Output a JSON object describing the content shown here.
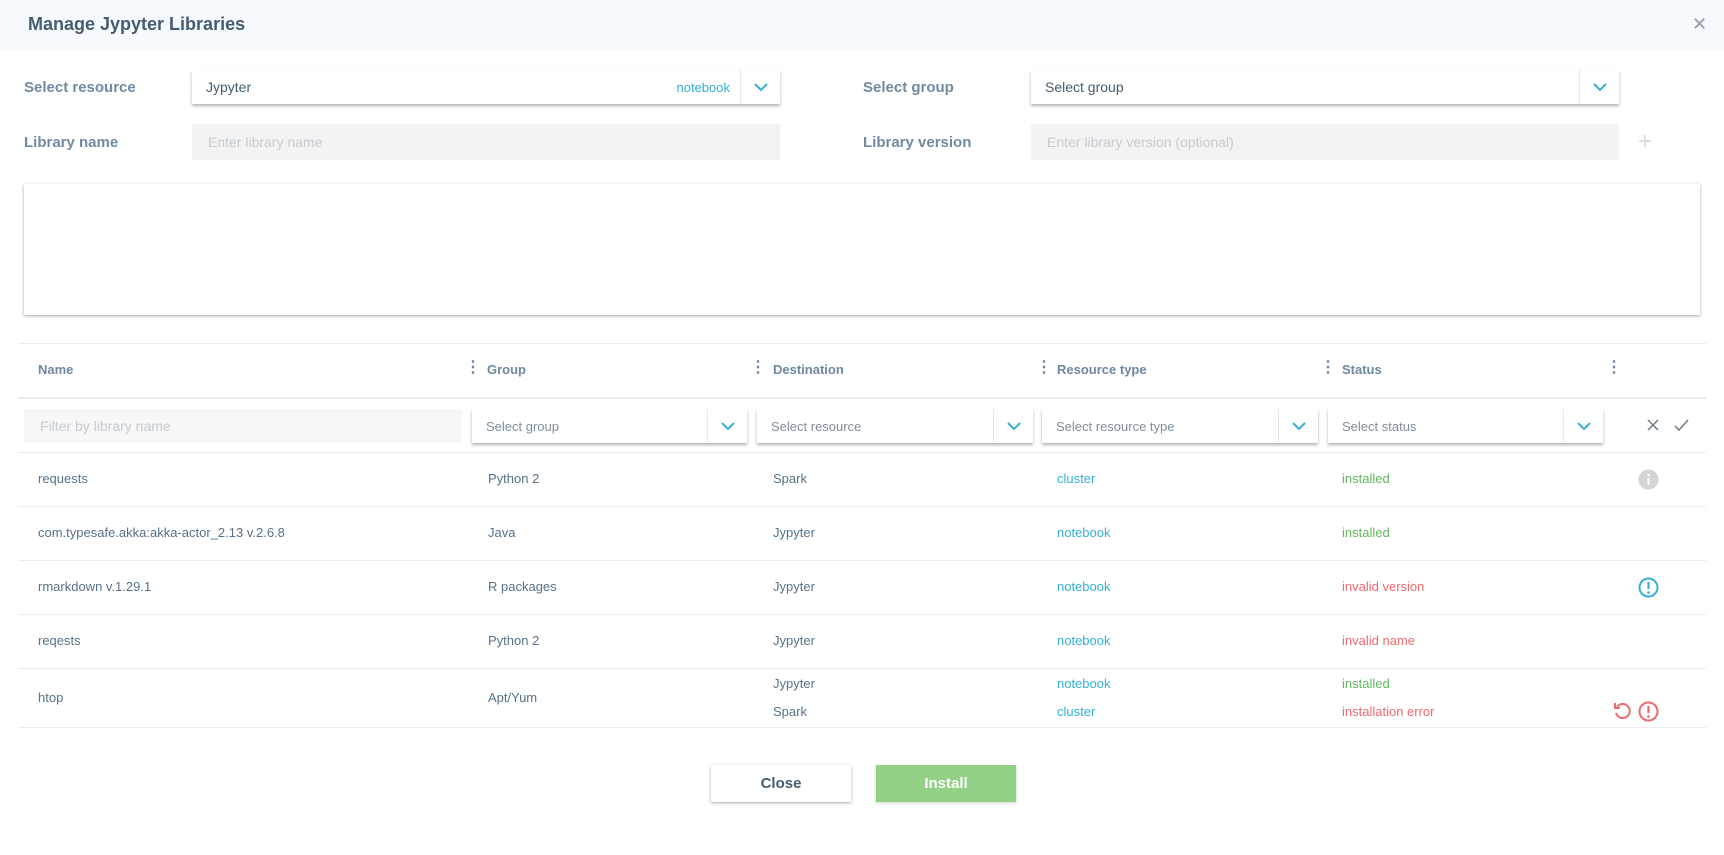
{
  "dialog": {
    "title": "Manage Jypyter Libraries"
  },
  "form": {
    "resource_label": "Select resource",
    "resource_value": "Jypyter",
    "resource_tag": "notebook",
    "group_label": "Select group",
    "group_placeholder": "Select group",
    "name_label": "Library name",
    "name_placeholder": "Enter library name",
    "version_label": "Library version",
    "version_placeholder": "Enter library version (optional)"
  },
  "table": {
    "columns": [
      "Name",
      "Group",
      "Destination",
      "Resource type",
      "Status"
    ],
    "filters": {
      "name_placeholder": "Filter by library name",
      "group": "Select group",
      "resource": "Select resource",
      "resource_type": "Select resource type",
      "status": "Select status"
    },
    "rows": [
      {
        "name": "requests",
        "group": "Python 2",
        "entries": [
          {
            "destination": "Spark",
            "type": "cluster",
            "status": "installed",
            "status_kind": "ok"
          }
        ],
        "icon": "info-icon"
      },
      {
        "name": "com.typesafe.akka:akka-actor_2.13  v.2.6.8",
        "group": "Java",
        "entries": [
          {
            "destination": "Jypyter",
            "type": "notebook",
            "status": "installed",
            "status_kind": "ok"
          }
        ]
      },
      {
        "name": "rmarkdown  v.1.29.1",
        "group": "R packages",
        "entries": [
          {
            "destination": "Jypyter",
            "type": "notebook",
            "status": "invalid version",
            "status_kind": "error"
          }
        ],
        "icon": "warning-icon"
      },
      {
        "name": "reqests",
        "group": "Python 2",
        "entries": [
          {
            "destination": "Jypyter",
            "type": "notebook",
            "status": "invalid name",
            "status_kind": "error"
          }
        ]
      },
      {
        "name": "htop",
        "group": "Apt/Yum",
        "entries": [
          {
            "destination": "Jypyter",
            "type": "notebook",
            "status": "installed",
            "status_kind": "ok"
          },
          {
            "destination": "Spark",
            "type": "cluster",
            "status": "installation error",
            "status_kind": "error"
          }
        ]
      }
    ]
  },
  "buttons": {
    "close": "Close",
    "install": "Install"
  },
  "colors": {
    "accent": "#35afd5",
    "installed": "#5fb85c",
    "error": "#ef6a6f",
    "install_button": "#92d086"
  }
}
